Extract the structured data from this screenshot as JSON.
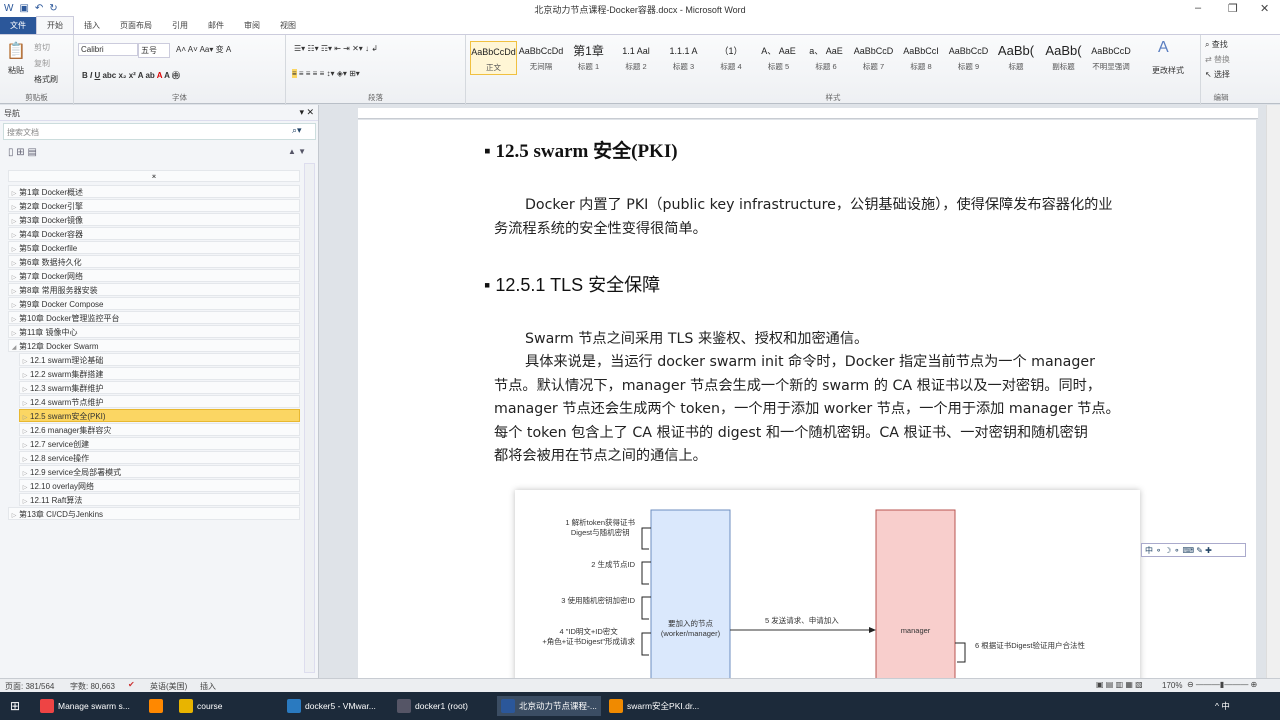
{
  "window": {
    "title": "北京动力节点课程-Docker容器.docx - Microsoft Word"
  },
  "tabs": [
    "文件",
    "开始",
    "插入",
    "页面布局",
    "引用",
    "邮件",
    "审阅",
    "视图"
  ],
  "ribbon": {
    "clipboard": {
      "paste": "粘贴",
      "cut": "剪切",
      "copy": "复制",
      "format_painter": "格式刷",
      "label": "剪贴板"
    },
    "font": {
      "name": "Calibri",
      "size": "五号",
      "label": "字体"
    },
    "paragraph": {
      "label": "段落"
    },
    "styles": {
      "label": "样式",
      "items": [
        {
          "preview": "AaBbCcDd",
          "name": "正文"
        },
        {
          "preview": "AaBbCcDd",
          "name": "无间隔"
        },
        {
          "preview": "第1章",
          "name": "标题 1"
        },
        {
          "preview": "1.1 Aal",
          "name": "标题 2"
        },
        {
          "preview": "1.1.1 A",
          "name": "标题 3"
        },
        {
          "preview": "（1）",
          "name": "标题 4"
        },
        {
          "preview": "A、 AaE",
          "name": "标题 5"
        },
        {
          "preview": "a、 AaE",
          "name": "标题 6"
        },
        {
          "preview": "AaBbCcD",
          "name": "标题 7"
        },
        {
          "preview": "AaBbCcI",
          "name": "标题 8"
        },
        {
          "preview": "AaBbCcD",
          "name": "标题 9"
        },
        {
          "preview": "AaBb(",
          "name": "标题"
        },
        {
          "preview": "AaBb(",
          "name": "副标题"
        },
        {
          "preview": "AaBbCcD",
          "name": "不明显强调"
        }
      ],
      "change_styles": "更改样式"
    },
    "editing": {
      "find": "查找",
      "replace": "替换",
      "select": "选择",
      "label": "编辑"
    }
  },
  "nav": {
    "title": "导航",
    "search_placeholder": "搜索文档",
    "items": [
      {
        "label": "第1章 Docker概述",
        "level": 1
      },
      {
        "label": "第2章  Docker引擎",
        "level": 1
      },
      {
        "label": "第3章 Docker镜像",
        "level": 1
      },
      {
        "label": "第4章 Docker容器",
        "level": 1
      },
      {
        "label": "第5章 Dockerfile",
        "level": 1
      },
      {
        "label": "第6章 数据持久化",
        "level": 1
      },
      {
        "label": "第7章 Docker网络",
        "level": 1
      },
      {
        "label": "第8章 常用服务器安装",
        "level": 1
      },
      {
        "label": "第9章 Docker Compose",
        "level": 1
      },
      {
        "label": "第10章 Docker管理监控平台",
        "level": 1
      },
      {
        "label": "第11章 镜像中心",
        "level": 1
      },
      {
        "label": "第12章 Docker Swarm",
        "level": 1,
        "expanded": true
      },
      {
        "label": "12.1 swarm理论基础",
        "level": 2
      },
      {
        "label": "12.2 swarm集群搭建",
        "level": 2
      },
      {
        "label": "12.3 swarm集群维护",
        "level": 2
      },
      {
        "label": "12.4 swarm节点维护",
        "level": 2
      },
      {
        "label": "12.5 swarm安全(PKI)",
        "level": 2,
        "selected": true
      },
      {
        "label": "12.6 manager集群容灾",
        "level": 2
      },
      {
        "label": "12.7 service创建",
        "level": 2
      },
      {
        "label": "12.8 service操作",
        "level": 2
      },
      {
        "label": "12.9 service全局部署模式",
        "level": 2
      },
      {
        "label": "12.10 overlay网络",
        "level": 2
      },
      {
        "label": "12.11 Raft算法",
        "level": 2
      },
      {
        "label": "第13章 CI/CD与Jenkins",
        "level": 1
      }
    ]
  },
  "doc": {
    "h1": "12.5    swarm 安全(PKI)",
    "p1": [
      "Docker 内置了 PKI（public key infrastructure，公钥基础设施），使得保障发布容器化的业",
      "务流程系统的安全性变得很简单。"
    ],
    "h2": "12.5.1  TLS 安全保障",
    "p2": "Swarm 节点之间采用 TLS 来鉴权、授权和加密通信。",
    "p3": [
      "具体来说是，当运行 docker swarm init 命令时，Docker 指定当前节点为一个 manager",
      "节点。默认情况下，manager 节点会生成一个新的 swarm 的 CA 根证书以及一对密钥。同时，",
      "manager 节点还会生成两个 token，一个用于添加 worker 节点，一个用于添加 manager 节点。",
      "每个 token 包含上了 CA 根证书的 digest 和一个随机密钥。CA 根证书、一对密钥和随机密钥",
      "都将会被用在节点之间的通信上。"
    ],
    "diagram": {
      "node": "要加入的节点\n(worker/manager)",
      "manager": "manager",
      "steps": [
        "1 解析token获得证书\nDigest与随机密钥",
        "2 生成节点ID",
        "3 使用随机密钥加密ID",
        "4 \"ID明文+ID密文\n+角色+证书Digest\"形成请求",
        "5 发送请求、申请加入",
        "6 根据证书Digest验证用户合法性"
      ]
    }
  },
  "ime": "中 ⚬ ☽ ⚬ ⌨ ✎ ✚",
  "status": {
    "page": "页面: 381/564",
    "words": "字数: 80,663",
    "lang": "英语(美国)",
    "mode": "插入",
    "zoom": "170%"
  },
  "taskbar": [
    {
      "label": "Manage swarm s...",
      "color": "#e44"
    },
    {
      "label": "",
      "color": "#f80"
    },
    {
      "label": "course",
      "color": "#e8b400"
    },
    {
      "label": "docker5 - VMwar...",
      "color": "#2a7ac0"
    },
    {
      "label": "docker1 (root)",
      "color": "#556"
    },
    {
      "label": "北京动力节点课程-...",
      "color": "#2b579a"
    },
    {
      "label": "swarm安全PKI.dr...",
      "color": "#f08a00"
    }
  ],
  "tray": "^ 中"
}
